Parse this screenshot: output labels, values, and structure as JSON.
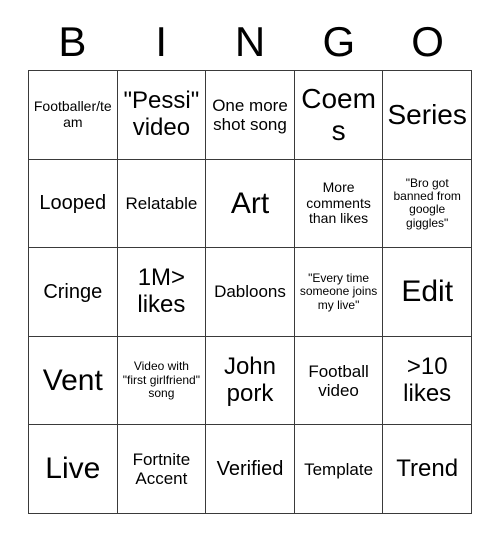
{
  "card": {
    "title_letters": [
      "B",
      "I",
      "N",
      "G",
      "O"
    ],
    "rows": [
      [
        {
          "text": "Footballer/team",
          "size": "xs"
        },
        {
          "text": "\"Pessi\" video",
          "size": "lg"
        },
        {
          "text": "One more shot song",
          "size": "sm"
        },
        {
          "text": "Coems",
          "size": "xl"
        },
        {
          "text": "Series",
          "size": "xl"
        }
      ],
      [
        {
          "text": "Looped",
          "size": "md"
        },
        {
          "text": "Relatable",
          "size": "sm"
        },
        {
          "text": "Art",
          "size": "xxl"
        },
        {
          "text": "More comments than likes",
          "size": "xs"
        },
        {
          "text": "\"Bro got banned from google giggles\"",
          "size": "xxs"
        }
      ],
      [
        {
          "text": "Cringe",
          "size": "md"
        },
        {
          "text": "1M> likes",
          "size": "lg"
        },
        {
          "text": "Dabloons",
          "size": "sm"
        },
        {
          "text": "\"Every time someone joins my live\"",
          "size": "xxs"
        },
        {
          "text": "Edit",
          "size": "xxl"
        }
      ],
      [
        {
          "text": "Vent",
          "size": "xxl"
        },
        {
          "text": "Video with \"first girlfriend\" song",
          "size": "xxs"
        },
        {
          "text": "John pork",
          "size": "lg"
        },
        {
          "text": "Football video",
          "size": "sm"
        },
        {
          "text": ">10 likes",
          "size": "lg"
        }
      ],
      [
        {
          "text": "Live",
          "size": "xxl"
        },
        {
          "text": "Fortnite Accent",
          "size": "sm"
        },
        {
          "text": "Verified",
          "size": "md"
        },
        {
          "text": "Template",
          "size": "sm"
        },
        {
          "text": "Trend",
          "size": "lg"
        }
      ]
    ]
  }
}
